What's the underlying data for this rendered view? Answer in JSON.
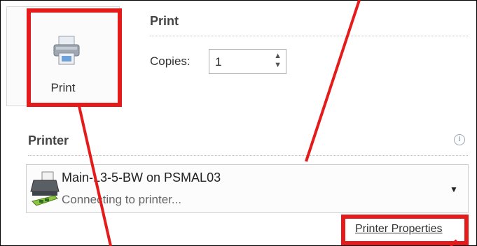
{
  "print_panel": {
    "print_button_label": "Print",
    "section_title": "Print",
    "copies_label": "Copies:",
    "copies_value": "1"
  },
  "printer_section": {
    "title": "Printer",
    "info_icon_glyph": "i",
    "selected_printer": {
      "name": "Main-L3-5-BW on PSMAL03",
      "status": "Connecting to printer..."
    },
    "properties_link": "Printer Properties"
  },
  "colors": {
    "annotation_red": "#e51a1a"
  }
}
